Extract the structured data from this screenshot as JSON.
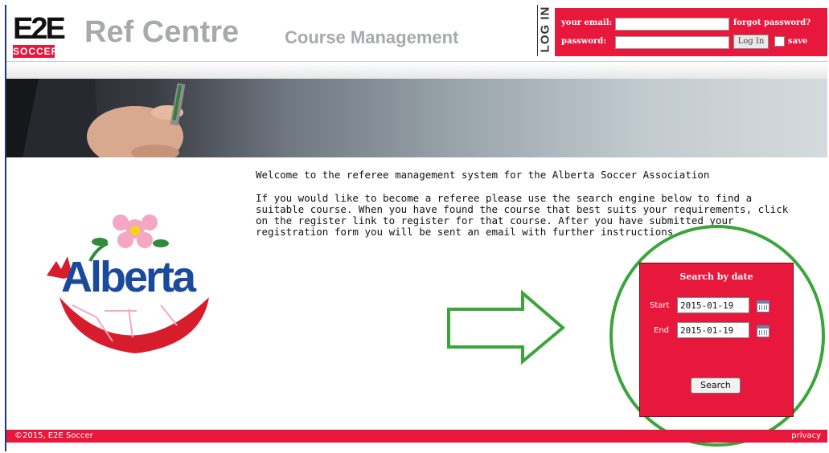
{
  "header": {
    "logo_e2e": "E2E",
    "logo_soccer": "SOCCER",
    "brand": "Ref Centre",
    "subbrand": "Course Management",
    "login_tab": "LOG IN"
  },
  "login": {
    "email_label": "your email:",
    "password_label": "password:",
    "forgot_label": "forgot password?",
    "login_button": "Log In",
    "save_label": "save"
  },
  "main": {
    "welcome": "Welcome to the referee management system for the Alberta Soccer Association",
    "intro": "If you would like to become a referee please use the search engine below to find a suitable course. When you have found the course that best suits your requirements, click on the register link to register for that course. After you have submitted your registration form you will be sent an email with further instructions",
    "logo_text": "Alberta"
  },
  "search": {
    "title": "Search by date",
    "start_label": "Start",
    "start_value": "2015-01-19",
    "end_label": "End",
    "end_value": "2015-01-19",
    "button": "Search"
  },
  "footer": {
    "copyright": "©2015, E2E Soccer",
    "privacy": "privacy"
  },
  "colors": {
    "accent": "#e8173c",
    "brand_gray": "#a7a9ad",
    "annotation_green": "#3aa53a"
  }
}
